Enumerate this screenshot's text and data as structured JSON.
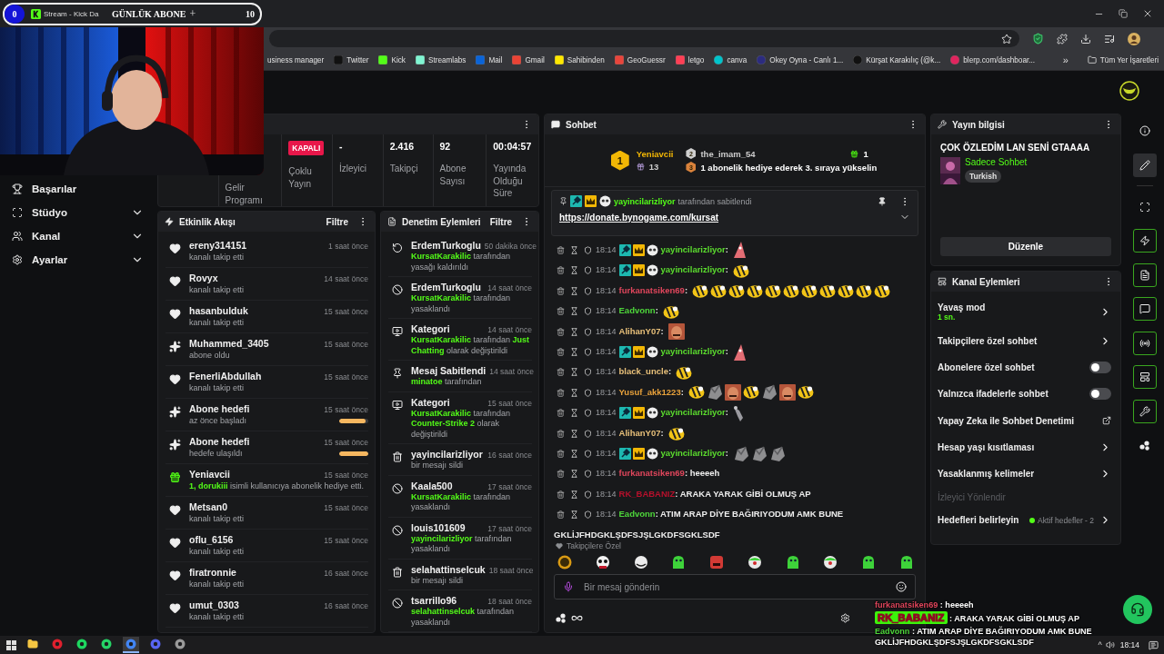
{
  "browser": {
    "tab_title": "Stream - Kick Da",
    "bookmarks": [
      {
        "label": "usiness manager"
      },
      {
        "label": "Twitter"
      },
      {
        "label": "Kick"
      },
      {
        "label": "Streamlabs"
      },
      {
        "label": "Mail"
      },
      {
        "label": "Gmail"
      },
      {
        "label": "Sahibinden"
      },
      {
        "label": "GeoGuessr"
      },
      {
        "label": "letgo"
      },
      {
        "label": "canva"
      },
      {
        "label": "Okey Oyna - Canlı 1..."
      },
      {
        "label": "Kürşat Karakılıç (@k..."
      },
      {
        "label": "blerp.com/dashboar..."
      }
    ],
    "more": "»",
    "all_bookmarks": "Tüm Yer İşaretleri"
  },
  "counter": {
    "count": "0",
    "label": "GÜNLÜK ABONE",
    "plus": "+",
    "goal": "10"
  },
  "sidebar": {
    "items": [
      {
        "label": "Başarılar",
        "expandable": false
      },
      {
        "label": "Stüdyo",
        "expandable": true
      },
      {
        "label": "Kanal",
        "expandable": true
      },
      {
        "label": "Ayarlar",
        "expandable": true
      }
    ]
  },
  "stats": {
    "items": [
      {
        "kind": "label",
        "label": "Gelir Programı"
      },
      {
        "kind": "badge",
        "badge": "KAPALI",
        "label": "Çoklu Yayın"
      },
      {
        "kind": "value",
        "value": "-",
        "label": "İzleyici"
      },
      {
        "kind": "value",
        "value": "2.416",
        "label": "Takipçi"
      },
      {
        "kind": "value",
        "value": "92",
        "label": "Abone Sayısı"
      },
      {
        "kind": "value",
        "value": "00:04:57",
        "label": "Yayında Olduğu Süre"
      }
    ]
  },
  "activity": {
    "title": "Etkinlik Akışı",
    "filter": "Filtre",
    "items": [
      {
        "kind": "follow",
        "user": "ereny314151",
        "text": "kanalı takip etti",
        "time": "1 saat önce"
      },
      {
        "kind": "follow",
        "user": "Rovyx",
        "text": "kanalı takip etti",
        "time": "14 saat önce"
      },
      {
        "kind": "follow",
        "user": "hasanbulduk",
        "text": "kanalı takip etti",
        "time": "15 saat önce"
      },
      {
        "kind": "sub",
        "user": "Muhammed_3405",
        "text": "abone oldu",
        "time": "15 saat önce"
      },
      {
        "kind": "follow",
        "user": "FenerliAbdullah",
        "text": "kanalı takip etti",
        "time": "15 saat önce"
      },
      {
        "kind": "goal",
        "user": "Abone hedefi",
        "text": "az önce başladı",
        "time": "15 saat önce",
        "level": 0.92
      },
      {
        "kind": "goal",
        "user": "Abone hedefi",
        "text": "hedefe ulaşıldı",
        "time": "15 saat önce",
        "level": 1
      },
      {
        "kind": "gift",
        "user": "Yeniavcii",
        "highlight": "1, dorukiii",
        "text": " isimli kullanıcıya abonelik hediye etti.",
        "time": "15 saat önce"
      },
      {
        "kind": "follow",
        "user": "Metsan0",
        "text": "kanalı takip etti",
        "time": "15 saat önce"
      },
      {
        "kind": "follow",
        "user": "oflu_6156",
        "text": "kanalı takip etti",
        "time": "15 saat önce"
      },
      {
        "kind": "follow",
        "user": "firatronnie",
        "text": "kanalı takip etti",
        "time": "16 saat önce"
      },
      {
        "kind": "follow",
        "user": "umut_0303",
        "text": "kanalı takip etti",
        "time": "16 saat önce"
      }
    ]
  },
  "moderation": {
    "title": "Denetim Eylemleri",
    "filter": "Filtre",
    "items": [
      {
        "kind": "unban",
        "title": "ErdemTurkoglu",
        "time": "50 dakika önce",
        "parts": [
          {
            "text": "KursatKarakilic",
            "highlight": true
          },
          {
            "text": " tarafından yasağı kaldırıldı",
            "highlight": false
          }
        ]
      },
      {
        "kind": "ban",
        "title": "ErdemTurkoglu",
        "time": "14 saat önce",
        "parts": [
          {
            "text": "KursatKarakilic",
            "highlight": true
          },
          {
            "text": " tarafından yasaklandı",
            "highlight": false
          }
        ]
      },
      {
        "kind": "category",
        "title": "Kategori",
        "time": "14 saat önce",
        "parts": [
          {
            "text": "KursatKarakilic",
            "highlight": true
          },
          {
            "text": " tarafından ",
            "highlight": false
          },
          {
            "text": "Just Chatting",
            "highlight": true
          },
          {
            "text": " olarak değiştirildi",
            "highlight": false
          }
        ]
      },
      {
        "kind": "pin",
        "title": "Mesaj Sabitlendi",
        "time": "14 saat önce",
        "parts": [
          {
            "text": "minatoe",
            "highlight": true
          },
          {
            "text": " tarafından",
            "highlight": false
          }
        ]
      },
      {
        "kind": "category",
        "title": "Kategori",
        "time": "15 saat önce",
        "parts": [
          {
            "text": "KursatKarakilic",
            "highlight": true
          },
          {
            "text": " tarafından ",
            "highlight": false
          },
          {
            "text": "Counter-Strike 2",
            "highlight": true
          },
          {
            "text": " olarak değiştirildi",
            "highlight": false
          }
        ]
      },
      {
        "kind": "delete",
        "title": "yayincilarizliyor",
        "time": "16 saat önce",
        "parts": [
          {
            "text": "bir mesajı sildi",
            "highlight": false
          }
        ]
      },
      {
        "kind": "ban",
        "title": "Kaala500",
        "time": "17 saat önce",
        "parts": [
          {
            "text": "KursatKarakilic",
            "highlight": true
          },
          {
            "text": " tarafından yasaklandı",
            "highlight": false
          }
        ]
      },
      {
        "kind": "ban",
        "title": "louis101609",
        "time": "17 saat önce",
        "parts": [
          {
            "text": "yayincilarizliyor",
            "highlight": true
          },
          {
            "text": " tarafından yasaklandı",
            "highlight": false
          }
        ]
      },
      {
        "kind": "delete",
        "title": "selahattinselcuk",
        "time": "18 saat önce",
        "parts": [
          {
            "text": "bir mesajı sildi",
            "highlight": false
          }
        ]
      },
      {
        "kind": "ban",
        "title": "tsarrillo96",
        "time": "18 saat önce",
        "parts": [
          {
            "text": "selahattinselcuk",
            "highlight": true
          },
          {
            "text": " tarafından yasaklandı",
            "highlight": false
          }
        ]
      }
    ]
  },
  "chat": {
    "title": "Sohbet",
    "leaderboard": {
      "first": {
        "rank": "1",
        "user": "Yeniavcii",
        "count": "13"
      },
      "second": {
        "rank": "2",
        "user": "the_imam_54",
        "count": "1"
      },
      "third": {
        "rank": "3",
        "text": "1 abonelik hediye ederek 3. sıraya yükselin"
      }
    },
    "pinned": {
      "user": "yayincilarizliyor",
      "badges": [
        {
          "kind": "mod"
        },
        {
          "kind": "vip"
        },
        {
          "kind": "panda"
        }
      ],
      "text": "tarafından sabitlendi",
      "link": "https://donate.bynogame.com/kursat"
    },
    "messages": [
      {
        "time": "18:14",
        "user": "yayincilarizliyor",
        "color": "#5bdc2e",
        "badges": [
          {
            "kind": "mod"
          },
          {
            "kind": "vip"
          },
          {
            "kind": "panda"
          }
        ],
        "text": ":",
        "emotes": [
          {
            "kind": "cone"
          }
        ]
      },
      {
        "time": "18:14",
        "user": "yayincilarizliyor",
        "color": "#5bdc2e",
        "badges": [
          {
            "kind": "mod"
          },
          {
            "kind": "vip"
          },
          {
            "kind": "panda"
          }
        ],
        "text": ":",
        "emotes": [
          {
            "kind": "bee"
          }
        ]
      },
      {
        "time": "18:14",
        "user": "furkanatsiken69",
        "color": "#e0465c",
        "text": ":",
        "emotes": [
          {
            "kind": "bee"
          },
          {
            "kind": "bee"
          },
          {
            "kind": "bee"
          },
          {
            "kind": "bee"
          },
          {
            "kind": "bee"
          },
          {
            "kind": "bee"
          },
          {
            "kind": "bee"
          },
          {
            "kind": "bee"
          },
          {
            "kind": "bee"
          },
          {
            "kind": "bee"
          },
          {
            "kind": "bee"
          }
        ]
      },
      {
        "time": "18:14",
        "user": "Eadvonn",
        "color": "#4ed63b",
        "text": ":",
        "emotes": [
          {
            "kind": "bee"
          }
        ]
      },
      {
        "time": "18:14",
        "user": "AlihanY07",
        "color": "#e8c07a",
        "text": ":",
        "emotes": [
          {
            "kind": "portrait"
          }
        ]
      },
      {
        "time": "18:14",
        "user": "yayincilarizliyor",
        "color": "#5bdc2e",
        "badges": [
          {
            "kind": "mod"
          },
          {
            "kind": "vip"
          },
          {
            "kind": "panda"
          }
        ],
        "text": ":",
        "emotes": [
          {
            "kind": "cone"
          }
        ]
      },
      {
        "time": "18:14",
        "user": "black_uncle",
        "color": "#e8c07a",
        "text": ":",
        "emotes": [
          {
            "kind": "bee"
          }
        ]
      },
      {
        "time": "18:14",
        "user": "Yusuf_akk1223",
        "color": "#e9a23b",
        "text": ":",
        "emotes": [
          {
            "kind": "bee"
          },
          {
            "kind": "rock"
          },
          {
            "kind": "portrait"
          },
          {
            "kind": "bee"
          },
          {
            "kind": "rock"
          },
          {
            "kind": "portrait"
          },
          {
            "kind": "bee"
          }
        ]
      },
      {
        "time": "18:14",
        "user": "yayincilarizliyor",
        "color": "#5bdc2e",
        "badges": [
          {
            "kind": "mod"
          },
          {
            "kind": "vip"
          },
          {
            "kind": "panda"
          }
        ],
        "text": ":",
        "emotes": [
          {
            "kind": "rat"
          }
        ]
      },
      {
        "time": "18:14",
        "user": "AlihanY07",
        "color": "#e8c07a",
        "text": ":",
        "emotes": [
          {
            "kind": "bee"
          }
        ]
      },
      {
        "time": "18:14",
        "user": "yayincilarizliyor",
        "color": "#5bdc2e",
        "badges": [
          {
            "kind": "mod"
          },
          {
            "kind": "vip"
          },
          {
            "kind": "panda"
          }
        ],
        "text": ":",
        "emotes": [
          {
            "kind": "rock"
          },
          {
            "kind": "rock"
          },
          {
            "kind": "rock"
          }
        ]
      },
      {
        "time": "18:14",
        "user": "furkanatsiken69",
        "color": "#e0465c",
        "text": ": heeeeh"
      },
      {
        "time": "18:14",
        "user": "RK_BABANIZ",
        "color": "#b8102c",
        "text": ": ARAKA YARAK GİBİ OLMUŞ AP"
      },
      {
        "time": "18:14",
        "user": "Eadvonn",
        "color": "#4ed63b",
        "text": ": ATIM ARAP DİYE BAĞIRIYODUM AMK BUNE GKLİJFHDGKLŞDFSJŞLGKDFSGKLSDF"
      }
    ],
    "mode_label": "Takipçilere Özel",
    "emote_bar": [
      {
        "kind": "coin"
      },
      {
        "kind": "panda"
      },
      {
        "kind": "ghost"
      },
      {
        "kind": "frog"
      },
      {
        "kind": "robot"
      },
      {
        "kind": "clown"
      },
      {
        "kind": "frog"
      },
      {
        "kind": "clown"
      },
      {
        "kind": "frog"
      },
      {
        "kind": "frog"
      }
    ],
    "input_placeholder": "Bir mesaj gönderin"
  },
  "stream_info": {
    "title": "Yayın bilgisi",
    "stream_title": "ÇOK ÖZLEDİM LAN SENİ GTAAAA",
    "category": "Sadece Sohbet",
    "tag": "Turkish",
    "button": "Düzenle"
  },
  "channel_actions": {
    "title": "Kanal Eylemleri",
    "items": [
      {
        "kind": "link",
        "label": "Yavaş mod",
        "value": "1 sn."
      },
      {
        "kind": "link",
        "label": "Takipçilere özel sohbet"
      },
      {
        "kind": "toggle",
        "label": "Abonelere özel sohbet",
        "on": false
      },
      {
        "kind": "toggle",
        "label": "Yalnızca ifadelerle sohbet",
        "on": false
      },
      {
        "kind": "external",
        "label": "Yapay Zeka ile Sohbet Denetimi"
      },
      {
        "kind": "link",
        "label": "Hesap yaşı kısıtlaması"
      },
      {
        "kind": "link",
        "label": "Yasaklanmış kelimeler"
      },
      {
        "kind": "section",
        "label": "İzleyici Yönlendir"
      },
      {
        "kind": "link",
        "label": "Hedefleri belirleyin",
        "status": "Aktif hedefler - 2"
      }
    ]
  },
  "rail": [
    {
      "kind": "info",
      "selected": false,
      "highlighted": false
    },
    {
      "kind": "edit",
      "selected": true,
      "highlighted": false
    },
    {
      "kind": "studio",
      "selected": false,
      "highlighted": false
    },
    {
      "kind": "bolt",
      "selected": false,
      "highlighted": true
    },
    {
      "kind": "doc",
      "selected": false,
      "highlighted": true
    },
    {
      "kind": "chat",
      "selected": false,
      "highlighted": true
    },
    {
      "kind": "broadcast",
      "selected": false,
      "highlighted": true
    },
    {
      "kind": "layout",
      "selected": false,
      "highlighted": true
    },
    {
      "kind": "wrench",
      "selected": false,
      "highlighted": true
    },
    {
      "kind": "dots",
      "selected": false,
      "highlighted": false
    }
  ],
  "overlay_chat": [
    {
      "user": "furkanatsiken69",
      "text": " : heeeeh",
      "color": "#e0465c",
      "boxed": false
    },
    {
      "user": "RK_BABANIZ",
      "text": " : ARAKA YARAK GİBİ OLMUŞ AP",
      "color": "#8e0c22",
      "boxed": true
    },
    {
      "user": "Eadvonn",
      "text": " : ATIM ARAP DİYE BAĞIRIYODUM AMK BUNE GKLİJFHDGKLŞDFSJŞLGKDFSGKLSDF",
      "color": "#4ed63b",
      "boxed": false
    }
  ],
  "taskbar": {
    "apps": [
      {
        "kind": "folder",
        "selected": false
      },
      {
        "kind": "opera",
        "selected": false
      },
      {
        "kind": "spotify",
        "selected": false
      },
      {
        "kind": "whatsapp",
        "selected": false
      },
      {
        "kind": "chrome",
        "selected": true
      },
      {
        "kind": "discord",
        "selected": false
      },
      {
        "kind": "globe",
        "selected": false
      }
    ],
    "caret": "^",
    "time": "18:14"
  }
}
